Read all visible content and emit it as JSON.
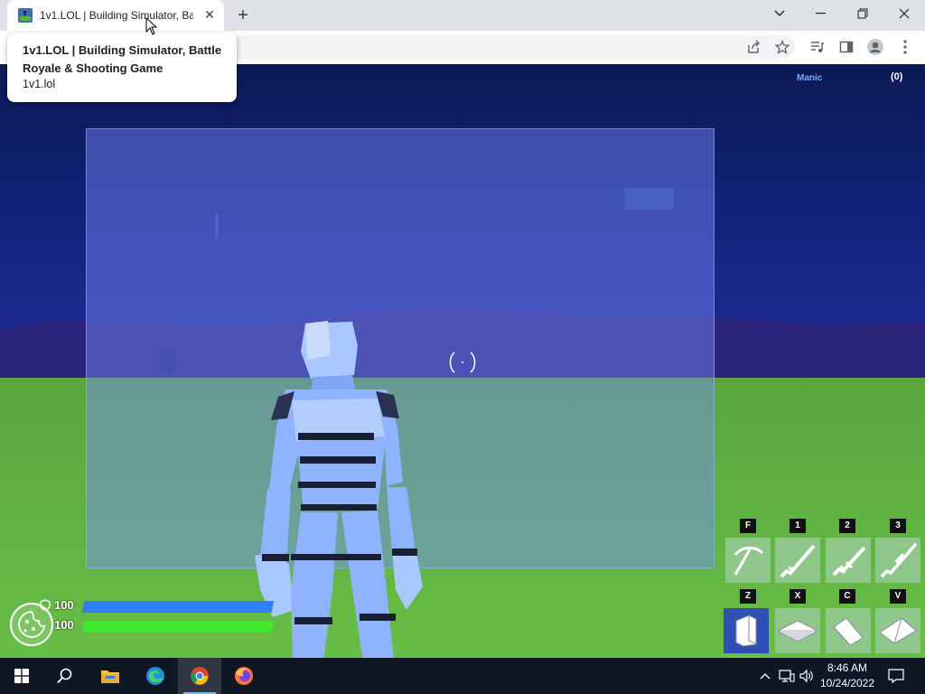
{
  "browser": {
    "tab_title": "1v1.LOL | Building Simulator, Battle Royale & Shooting Game",
    "tab_close": "✕",
    "new_tab": "+",
    "hover_card": {
      "title": "1v1.LOL | Building Simulator, Battle Royale & Shooting Game",
      "domain": "1v1.lol"
    }
  },
  "game": {
    "player_name": "Manic",
    "kill_count": "(0)",
    "shield": "100",
    "health": "100",
    "shield_fraction": 1.0,
    "health_fraction": 1.0,
    "colors": {
      "shield_bar": "#2f7fff",
      "health_bar": "#3ee82c",
      "slot_bg": "#8fc68a",
      "slot_selected": "#2f4fb8"
    },
    "weapon_slots": [
      {
        "key": "F",
        "icon": "pickaxe-icon"
      },
      {
        "key": "1",
        "icon": "shotgun-icon"
      },
      {
        "key": "2",
        "icon": "assault-rifle-icon"
      },
      {
        "key": "3",
        "icon": "sniper-rifle-icon"
      }
    ],
    "build_slots": [
      {
        "key": "Z",
        "icon": "wall-icon",
        "selected": true
      },
      {
        "key": "X",
        "icon": "floor-icon",
        "selected": false
      },
      {
        "key": "C",
        "icon": "ramp-icon",
        "selected": false
      },
      {
        "key": "V",
        "icon": "cone-icon",
        "selected": false
      }
    ]
  },
  "taskbar": {
    "time": "8:46 AM",
    "date": "10/24/2022"
  }
}
